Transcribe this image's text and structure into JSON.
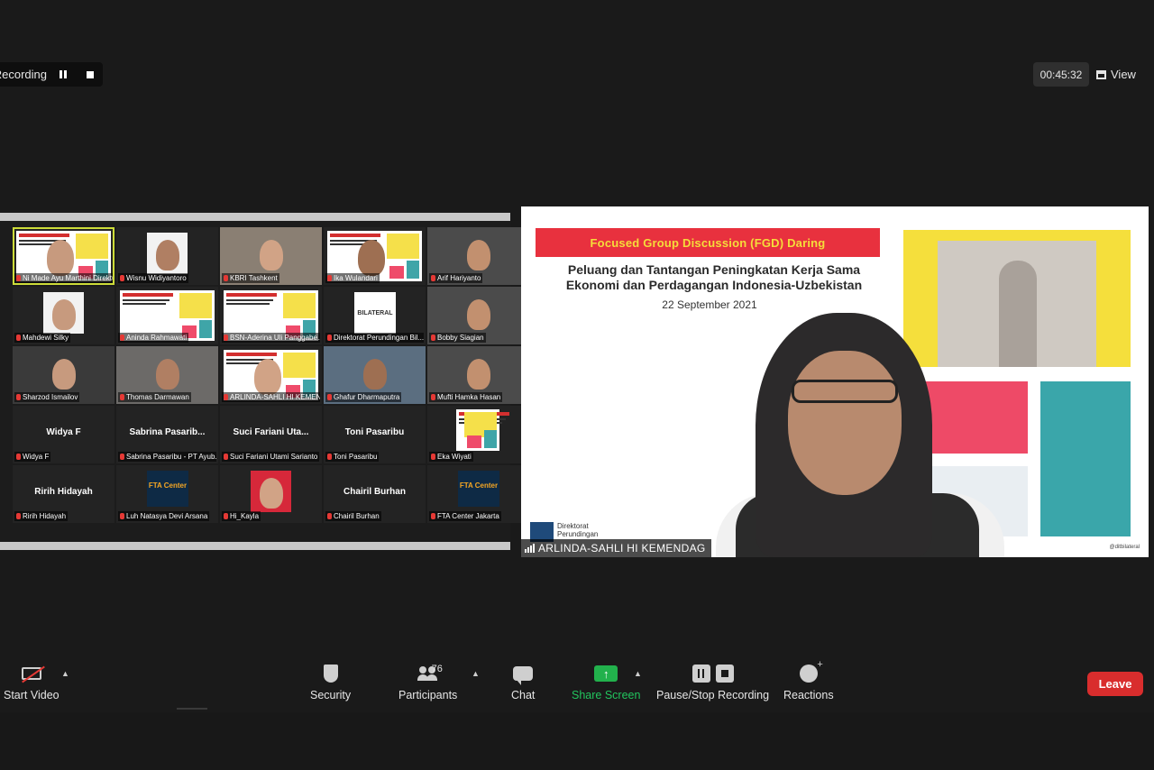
{
  "top": {
    "recording_text": "Recording...",
    "timer": "00:45:32",
    "view_label": "View"
  },
  "gallery": {
    "tiles": [
      {
        "name": "Ni Made Ayu Marthini Direktu..."
      },
      {
        "name": "Wisnu Widiyantoro"
      },
      {
        "name": "KBRI Tashkent"
      },
      {
        "name": "Ika Wulandari"
      },
      {
        "name": "Arif Hariyanto"
      },
      {
        "name": "Mahdewi Silky"
      },
      {
        "name": "Aninda Rahmawati"
      },
      {
        "name": "BSN-Aderina Uli Panggabe..."
      },
      {
        "name": "Direktorat Perundingan Bil..."
      },
      {
        "name": "Bobby Siagian"
      },
      {
        "name": "Sharzod Ismailov"
      },
      {
        "name": "Thomas Darmawan"
      },
      {
        "name": "ARLINDA-SAHLI HI KEMEN..."
      },
      {
        "name": "Ghafur Dharmaputra"
      },
      {
        "name": "Mufti Hamka Hasan"
      },
      {
        "name": "Widya F",
        "big": "Widya F"
      },
      {
        "name": "Sabrina Pasaribu - PT Ayub...",
        "big": "Sabrina Pasarib..."
      },
      {
        "name": "Suci Fariani Utami Sarianto",
        "big": "Suci Fariani Uta..."
      },
      {
        "name": "Toni Pasaribu",
        "big": "Toni Pasaribu"
      },
      {
        "name": "Eka Wiyati"
      },
      {
        "name": "Ririh Hidayah",
        "big": "Ririh Hidayah"
      },
      {
        "name": "Luh Natasya Devi Arsana",
        "fta": "FTA Center"
      },
      {
        "name": "Hi_Kayla"
      },
      {
        "name": "Chairil Burhan",
        "big": "Chairil Burhan"
      },
      {
        "name": "FTA Center Jakarta",
        "fta": "FTA Center"
      }
    ],
    "bilateral_logo_text": "BILATERAL"
  },
  "main": {
    "banner": "Focused Group Discussion (FGD) Daring",
    "title_line1": "Peluang dan Tantangan Peningkatan Kerja Sama",
    "title_line2": "Ekonomi dan Perdagangan Indonesia-Uzbekistan",
    "date": "22 September 2021",
    "logo_text": "Direktorat Perundingan",
    "social": "@ditbilateral",
    "speaker_label": "ARLINDA-SAHLI HI KEMENDAG"
  },
  "toolbar": {
    "start_video": "Start Video",
    "security": "Security",
    "participants": "Participants",
    "participants_count": "76",
    "chat": "Chat",
    "share_screen": "Share Screen",
    "recording": "Pause/Stop Recording",
    "reactions": "Reactions",
    "leave": "Leave"
  },
  "colors": {
    "active_speaker": "#cddc39",
    "share_green": "#22b14c",
    "leave_red": "#d92d2d",
    "banner_red": "#e8313e",
    "banner_yellow": "#f5dd3a"
  }
}
